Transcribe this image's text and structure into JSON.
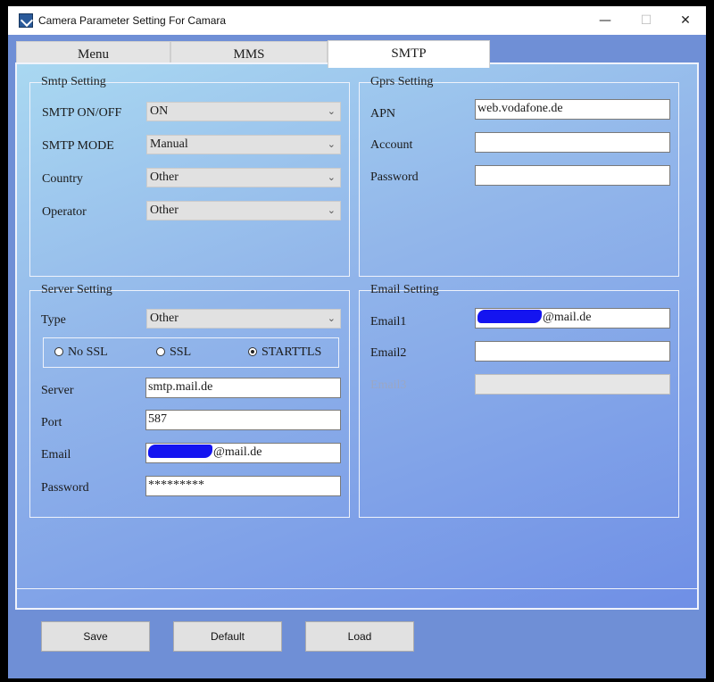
{
  "window": {
    "title": "Camera Parameter Setting For  Camara",
    "minimize_glyph": "—",
    "maximize_glyph": "☐",
    "close_glyph": "✕"
  },
  "tabs": [
    {
      "label": "Menu",
      "active": false
    },
    {
      "label": "MMS",
      "active": false
    },
    {
      "label": "SMTP",
      "active": true
    }
  ],
  "smtp_setting": {
    "title": "Smtp Setting",
    "rows": [
      {
        "label": "SMTP ON/OFF",
        "value": "ON"
      },
      {
        "label": "SMTP MODE",
        "value": "Manual"
      },
      {
        "label": "Country",
        "value": "Other"
      },
      {
        "label": "Operator",
        "value": "Other"
      }
    ]
  },
  "gprs_setting": {
    "title": "Gprs Setting",
    "rows": [
      {
        "label": "APN",
        "value": "web.vodafone.de"
      },
      {
        "label": "Account",
        "value": ""
      },
      {
        "label": "Password",
        "value": ""
      }
    ]
  },
  "server_setting": {
    "title": "Server Setting",
    "type_label": "Type",
    "type_value": "Other",
    "security": {
      "options": [
        "No SSL",
        "SSL",
        "STARTTLS"
      ],
      "selected": "STARTTLS"
    },
    "server_label": "Server",
    "server_value": "smtp.mail.de",
    "port_label": "Port",
    "port_value": "587",
    "email_label": "Email",
    "email_value": "@mail.de",
    "password_label": "Password",
    "password_value": "*********"
  },
  "email_setting": {
    "title": "Email Setting",
    "email1_label": "Email1",
    "email1_value": "@mail.de",
    "email2_label": "Email2",
    "email2_value": "",
    "email3_label": "Email3",
    "email3_value": ""
  },
  "buttons": {
    "save": "Save",
    "default": "Default",
    "load": "Load"
  },
  "icons": {
    "dropdown": "chevron-down-icon",
    "app": "app-icon"
  }
}
